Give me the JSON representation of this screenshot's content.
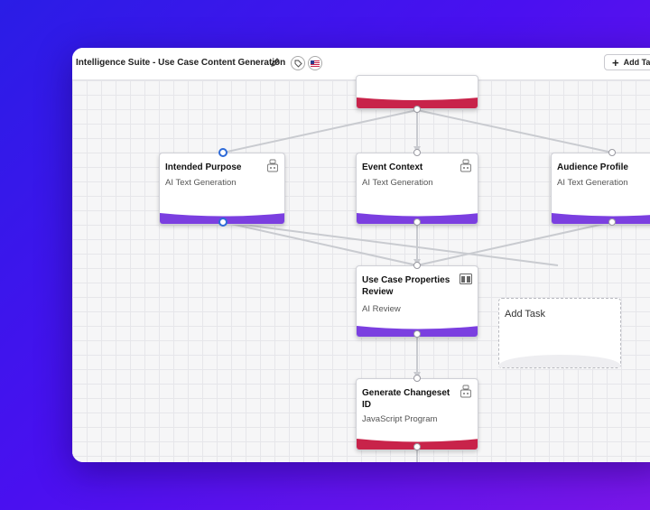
{
  "header": {
    "title": "Intelligence Suite - Use Case Content Generation",
    "add_task_label": "Add Task"
  },
  "nodes": {
    "intended_purpose": {
      "title": "Intended Purpose",
      "subtitle": "AI Text Generation"
    },
    "event_context": {
      "title": "Event Context",
      "subtitle": "AI Text Generation"
    },
    "audience_profile": {
      "title": "Audience Profile",
      "subtitle": "AI Text Generation"
    },
    "use_case_review": {
      "title": "Use Case Properties Review",
      "subtitle": "AI Review"
    },
    "changeset": {
      "title": "Generate Changeset ID",
      "subtitle": "JavaScript Program"
    }
  },
  "add_task_placeholder": {
    "label": "Add Task"
  },
  "colors": {
    "ai_generation": "#7b3fe0",
    "ai_review": "#7b3fe0",
    "program": "#c8234a",
    "accent": "#2d6ad8"
  }
}
